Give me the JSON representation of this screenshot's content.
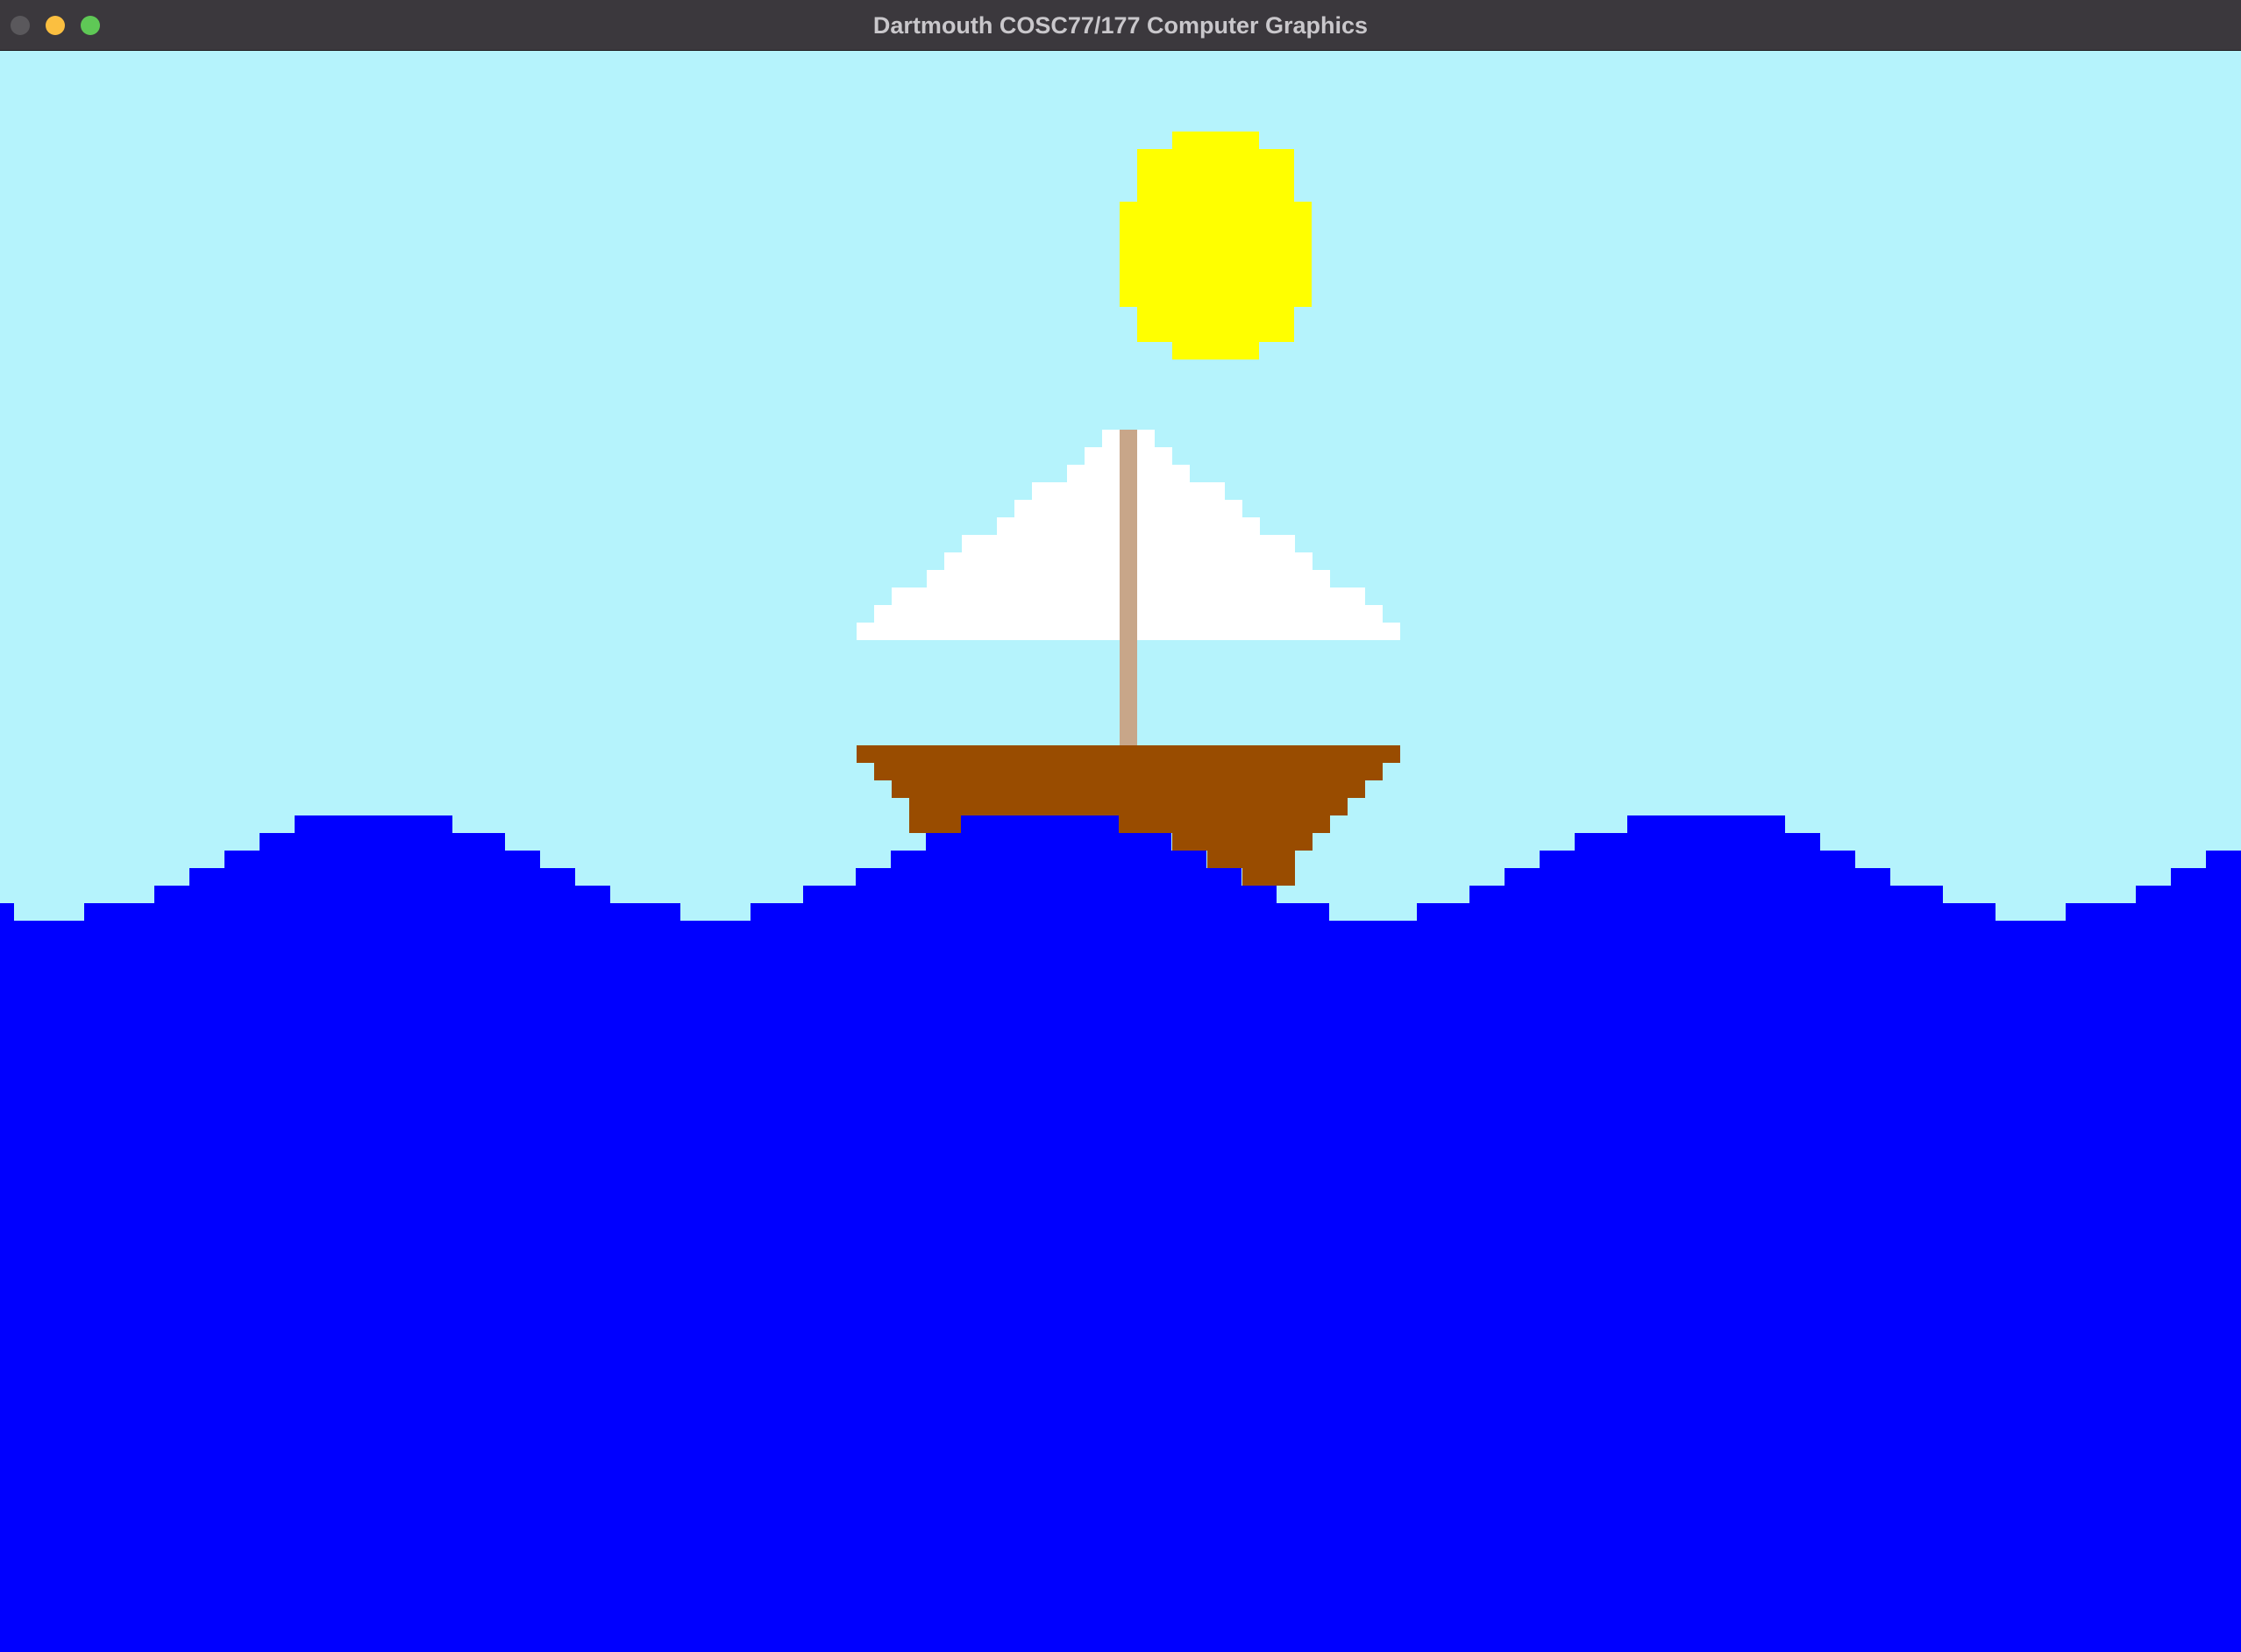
{
  "window": {
    "title": "Dartmouth COSC77/177 Computer Graphics"
  },
  "scene": {
    "colors": {
      "sky": "#b5f3fc",
      "sun": "#ffff00",
      "sail": "#ffffff",
      "mast": "#c8a689",
      "hull": "#994c00",
      "water": "#0000ff"
    },
    "elements": [
      "sky",
      "sun",
      "sail",
      "mast",
      "hull",
      "waves"
    ]
  }
}
